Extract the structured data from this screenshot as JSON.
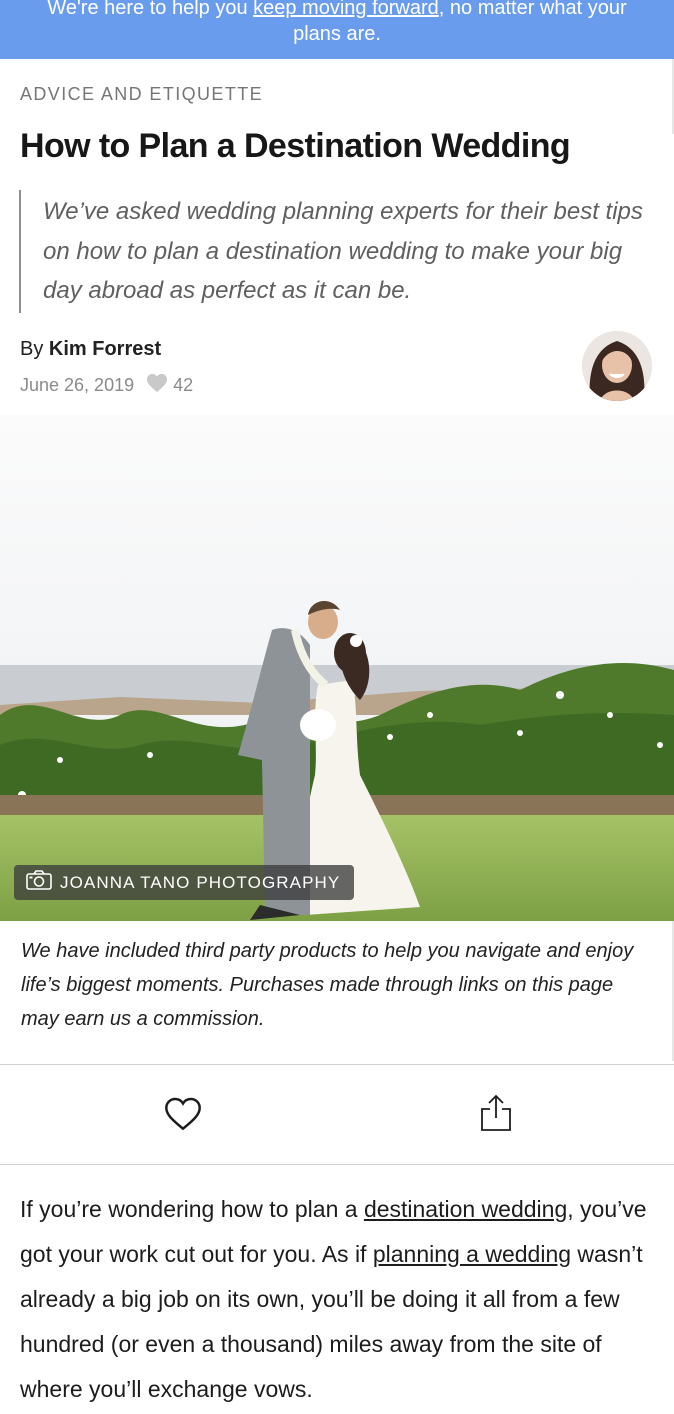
{
  "banner": {
    "text_before": "We're here to help you ",
    "link": "keep moving forward",
    "text_after": ", no matter what your plans are."
  },
  "article": {
    "category": "ADVICE AND ETIQUETTE",
    "title": "How to Plan a Destination Wedding",
    "summary": "We’ve asked wedding planning experts for their best tips on how to plan a destination wedding to make your big day abroad as perfect as it can be.",
    "byline_prefix": "By ",
    "author": "Kim Forrest",
    "date": "June 26, 2019",
    "likes": "42",
    "photo_credit": "JOANNA TANO PHOTOGRAPHY",
    "disclaimer": "We have included third party products to help you navigate and enjoy life’s biggest moments. Purchases made through links on this page may earn us a commission.",
    "body": {
      "p1": "If you’re wondering how to plan a ",
      "link1": "destination wedding",
      "p2": ", you’ve got your work cut out for you. As if ",
      "link2": "planning a wedding",
      "p3": " wasn’t already a big job on its own, you’ll be doing it all from a few hundred (or even a thousand) miles away from the site of where you’ll exchange vows."
    }
  },
  "icons": {
    "like": "heart-outline-icon",
    "share": "share-icon",
    "camera": "camera-icon",
    "likes_count": "heart-filled-icon"
  },
  "colors": {
    "banner": "#6a9ced",
    "muted": "#8b8b8b",
    "heart": "#c9c9c9"
  }
}
